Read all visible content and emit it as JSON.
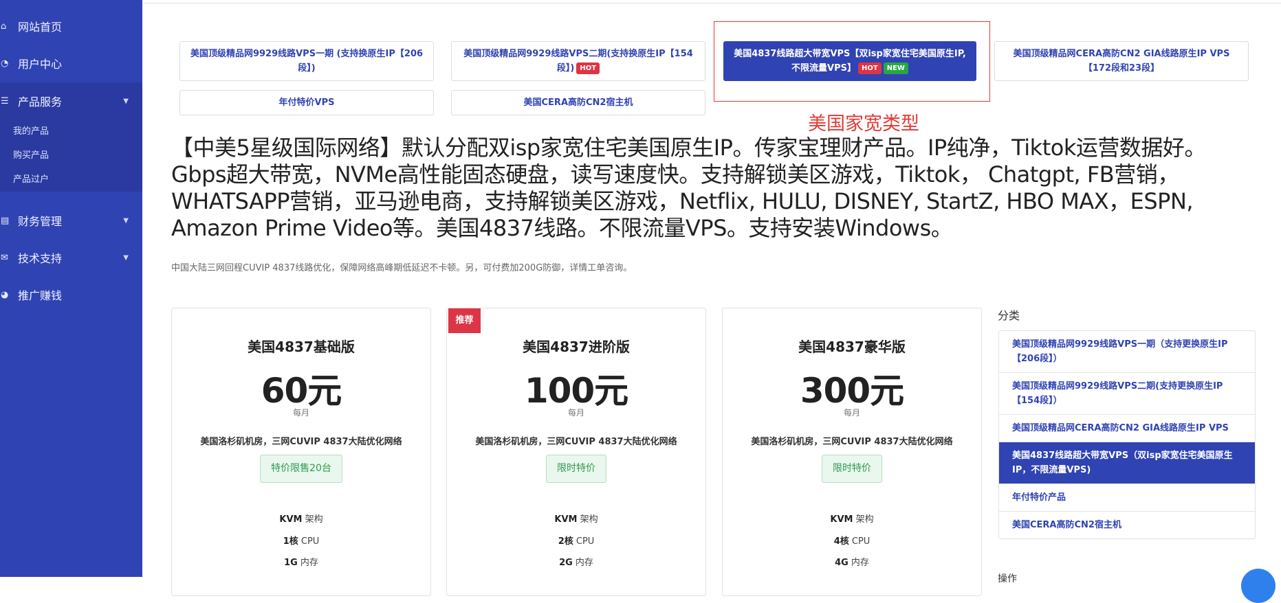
{
  "sidebar": {
    "items": [
      {
        "label": "网站首页",
        "icon": "home-icon"
      },
      {
        "label": "用户中心",
        "icon": "dashboard-icon"
      },
      {
        "label": "产品服务",
        "icon": "list-icon"
      },
      {
        "label": "财务管理",
        "icon": "finance-icon"
      },
      {
        "label": "技术支持",
        "icon": "support-icon"
      },
      {
        "label": "推广赚钱",
        "icon": "pie-icon"
      }
    ],
    "sub_items": [
      "我的产品",
      "购买产品",
      "产品过户"
    ]
  },
  "categories": [
    {
      "label": "美国顶级精品网9929线路VPS一期 (支持换原生IP【206段】)"
    },
    {
      "label": "美国顶级精品网9929线路VPS二期(支持换原生IP【154段】)",
      "badge": "HOT"
    },
    {
      "label": "美国4837线路超大带宽VPS【双isp家宽住宅美国原生IP,不限流量VPS】",
      "badge1": "HOT",
      "badge2": "NEW"
    },
    {
      "label": "美国顶级精品网CERA高防CN2 GIA线路原生IP VPS【172段和23段】"
    },
    {
      "label": "年付特价VPS"
    },
    {
      "label": "美国CERA高防CN2宿主机"
    }
  ],
  "annotation": "美国家宽类型",
  "headline": "【中美5星级国际网络】默认分配双isp家宽住宅美国原生IP。传家宝理财产品。IP纯净，Tiktok运营数据好。Gbps超大带宽，NVMe高性能固态硬盘，读写速度快。支持解锁美区游戏，Tiktok， Chatgpt, FB营销，WHATSAPP营销，亚马逊电商，支持解锁美区游戏，Netflix, HULU, DISNEY, StartZ, HBO MAX，ESPN, Amazon Prime Video等。美国4837线路。不限流量VPS。支持安装Windows。",
  "subline": "中国大陆三网回程CUVIP 4837线路优化，保障网络高峰期低延迟不卡顿。另，可付费加200G防御，详情工单咨询。",
  "plans": [
    {
      "name": "美国4837基础版",
      "price": "60元",
      "period": "每月",
      "desc": "美国洛杉矶机房，三网CUVIP 4837大陆优化网络",
      "promo": "特价限售20台",
      "arch_v": "KVM",
      "arch_l": "架构",
      "cpu_v": "1核",
      "cpu_l": "CPU",
      "mem_v": "1G",
      "mem_l": "内存"
    },
    {
      "name": "美国4837进阶版",
      "price": "100元",
      "period": "每月",
      "desc": "美国洛杉矶机房，三网CUVIP 4837大陆优化网络",
      "promo": "限时特价",
      "arch_v": "KVM",
      "arch_l": "架构",
      "cpu_v": "2核",
      "cpu_l": "CPU",
      "mem_v": "2G",
      "mem_l": "内存",
      "ribbon": "推荐"
    },
    {
      "name": "美国4837豪华版",
      "price": "300元",
      "period": "每月",
      "desc": "美国洛杉矶机房，三网CUVIP 4837大陆优化网络",
      "promo": "限时特价",
      "arch_v": "KVM",
      "arch_l": "架构",
      "cpu_v": "4核",
      "cpu_l": "CPU",
      "mem_v": "4G",
      "mem_l": "内存"
    }
  ],
  "side": {
    "title": "分类",
    "items": [
      "美国顶级精品网9929线路VPS一期（支持更换原生IP【206段】）",
      "美国顶级精品网9929线路VPS二期(支持更换原生IP【154段】）",
      "美国顶级精品网CERA高防CN2 GIA线路原生IP VPS",
      "美国4837线路超大带宽VPS（双isp家宽住宅美国原生IP，不限流量VPS)",
      "年付特价产品",
      "美国CERA高防CN2宿主机"
    ],
    "next": "操作"
  },
  "colors": {
    "primary": "#3043b3",
    "hot": "#dc3545",
    "new": "#28a745",
    "annotation": "#e53935"
  }
}
